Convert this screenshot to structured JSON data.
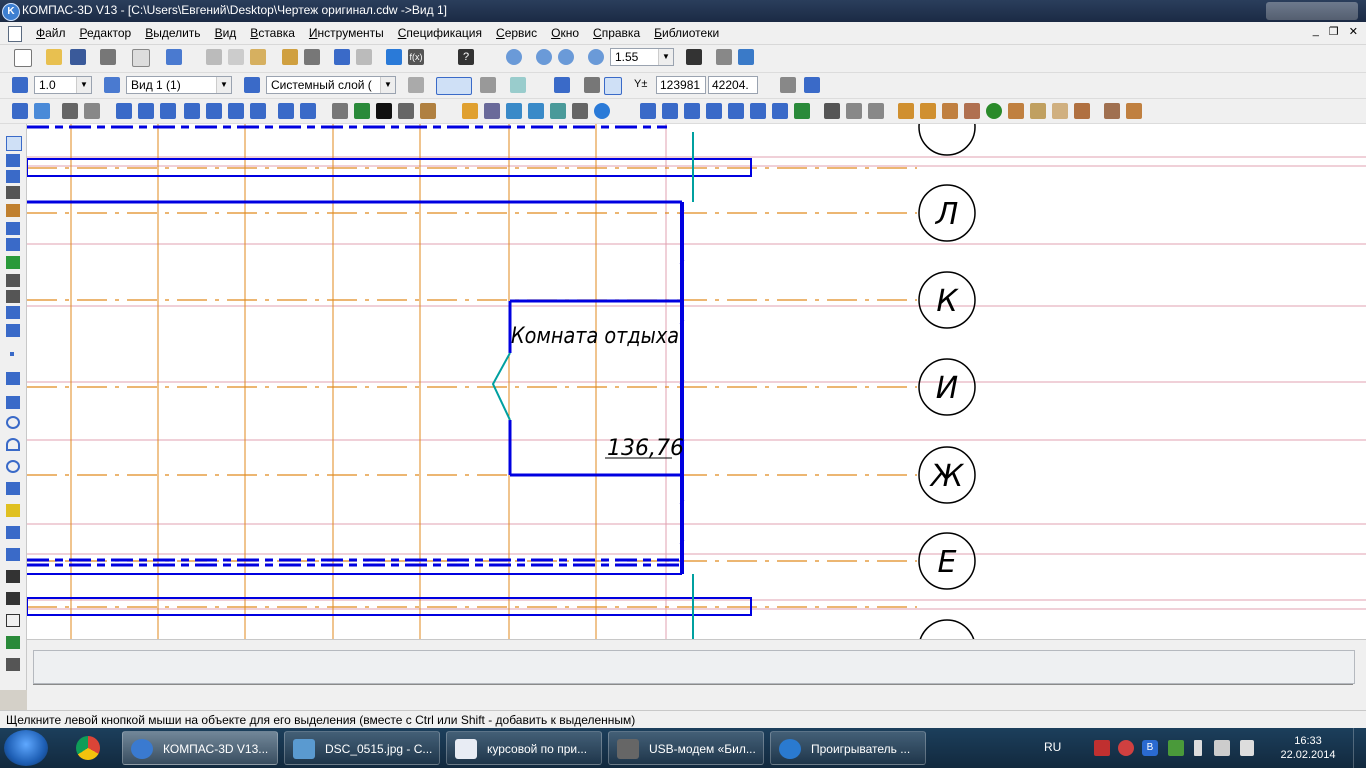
{
  "window": {
    "title": "КОМПАС-3D V13 - [C:\\Users\\Евгений\\Desktop\\Чертеж оригинал.cdw ->Вид 1]"
  },
  "menu": {
    "items": [
      "Файл",
      "Редактор",
      "Выделить",
      "Вид",
      "Вставка",
      "Инструменты",
      "Спецификация",
      "Сервис",
      "Окно",
      "Справка",
      "Библиотеки"
    ]
  },
  "toolbar1": {
    "zoom_value": "1.55"
  },
  "toolbar2": {
    "scale_value": "1.0",
    "view_value": "Вид 1 (1)",
    "layer_value": "Системный слой (",
    "coord_x": "123981",
    "coord_y": "42204.",
    "coord_label": "Y±"
  },
  "drawing": {
    "room_name": "Комната отдыха",
    "room_area": "136,76",
    "axis_labels": [
      "Л",
      "К",
      "И",
      "Ж",
      "Е"
    ],
    "colors": {
      "wall": "#0000e0",
      "axis": "#e08a1e",
      "grid": "#e0a0b0",
      "teal": "#00a0a0"
    }
  },
  "statusbar": {
    "hint": "Щелкните левой кнопкой мыши на объекте для его выделения (вместе с Ctrl или Shift - добавить к выделенным)"
  },
  "taskbar": {
    "tasks": [
      {
        "label": "КОМПАС-3D V13...",
        "icon": "kompas-icon"
      },
      {
        "label": "DSC_0515.jpg - C...",
        "icon": "image-viewer-icon"
      },
      {
        "label": "курсовой по при...",
        "icon": "word-icon"
      },
      {
        "label": "USB-модем «Бил...",
        "icon": "modem-icon"
      },
      {
        "label": "Проигрыватель ...",
        "icon": "media-player-icon"
      }
    ],
    "language": "RU",
    "time": "16:33",
    "date": "22.02.2014"
  }
}
